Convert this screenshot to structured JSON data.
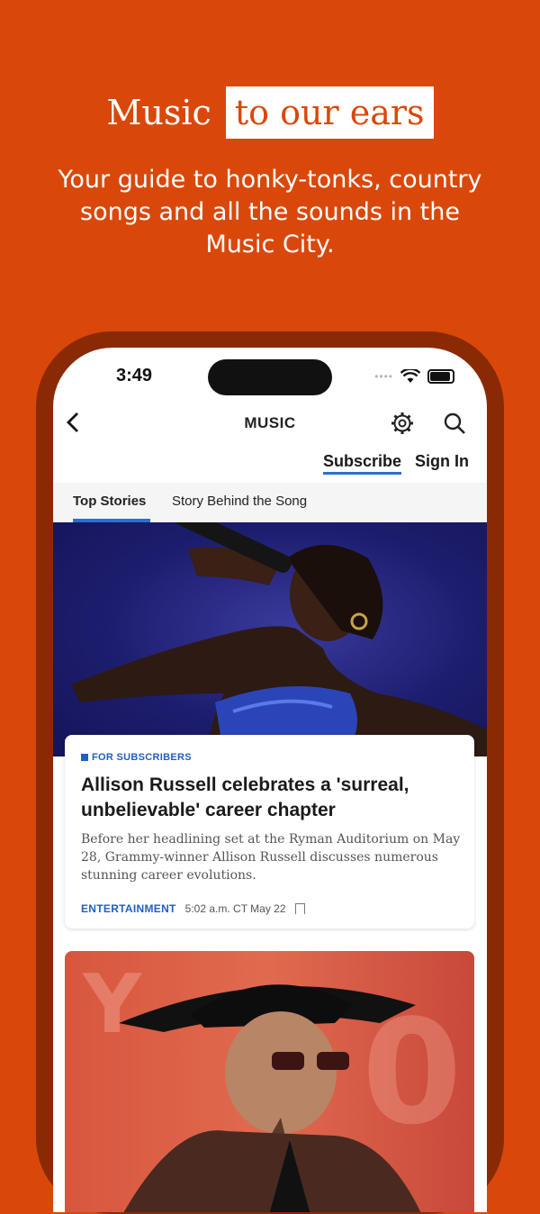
{
  "promo": {
    "headline_plain": "Music",
    "headline_highlight": "to our ears",
    "subhead": "Your guide to honky-tonks, country songs and all the sounds in the Music City."
  },
  "status_bar": {
    "time": "3:49"
  },
  "nav": {
    "title": "MUSIC",
    "subscribe": "Subscribe",
    "sign_in": "Sign In"
  },
  "tabs": [
    {
      "label": "Top Stories",
      "active": true
    },
    {
      "label": "Story Behind the Song",
      "active": false
    }
  ],
  "article": {
    "badge": "FOR SUBSCRIBERS",
    "title": "Allison Russell celebrates a 'surreal, unbelievable' career chapter",
    "description": "Before her headlining set at the Ryman Auditorium on May 28, Grammy-winner Allison Russell discusses numerous stunning career evolutions.",
    "category": "ENTERTAINMENT",
    "timestamp": "5:02 a.m. CT May 22"
  },
  "colors": {
    "brand": "#d9480a",
    "accent": "#2a6fd6"
  }
}
